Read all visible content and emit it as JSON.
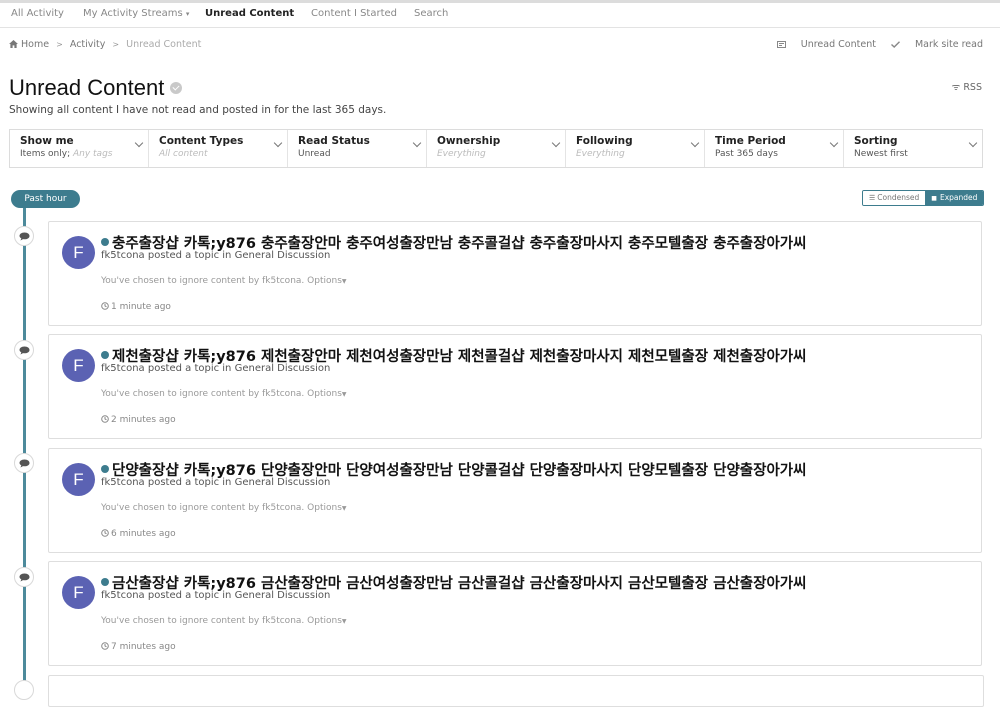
{
  "nav": {
    "tabs": [
      {
        "label": "All Activity"
      },
      {
        "label": "My Activity Streams",
        "caret": "▾"
      },
      {
        "label": "Unread Content"
      },
      {
        "label": "Content I Started"
      },
      {
        "label": "Search"
      }
    ]
  },
  "breadcrumb": {
    "items": [
      "Home",
      "Activity",
      "Unread Content"
    ]
  },
  "header_actions": {
    "unread": "Unread Content",
    "mark_read": "Mark site read"
  },
  "page": {
    "title": "Unread Content",
    "subtitle": "Showing all content I have not read and posted in for the last 365 days.",
    "rss": "RSS"
  },
  "filters": [
    {
      "title": "Show me",
      "value": "Items only;",
      "placeholder": "Any tags"
    },
    {
      "title": "Content Types",
      "value": "",
      "placeholder": "All content"
    },
    {
      "title": "Read Status",
      "value": "Unread",
      "placeholder": ""
    },
    {
      "title": "Ownership",
      "value": "",
      "placeholder": "Everything"
    },
    {
      "title": "Following",
      "value": "",
      "placeholder": "Everything"
    },
    {
      "title": "Time Period",
      "value": "Past 365 days",
      "placeholder": ""
    },
    {
      "title": "Sorting",
      "value": "Newest first",
      "placeholder": ""
    }
  ],
  "timeline": {
    "period_label": "Past hour",
    "view_condensed": "Condensed",
    "view_expanded": "Expanded"
  },
  "items": [
    {
      "avatar": "F",
      "title": "충주출장샵 카톡;y876 충주출장안마 충주여성출장만남 충주콜걸샵 충주출장마사지 충주모텔출장 충주출장아가씨",
      "meta": "fk5tcona posted a topic in General Discussion",
      "ignore": "You've chosen to ignore content by fk5tcona.",
      "options": "Options",
      "time": "1 minute ago"
    },
    {
      "avatar": "F",
      "title": "제천출장샵 카톡;y876 제천출장안마 제천여성출장만남 제천콜걸샵 제천출장마사지 제천모텔출장 제천출장아가씨",
      "meta": "fk5tcona posted a topic in General Discussion",
      "ignore": "You've chosen to ignore content by fk5tcona.",
      "options": "Options",
      "time": "2 minutes ago"
    },
    {
      "avatar": "F",
      "title": "단양출장샵 카톡;y876 단양출장안마 단양여성출장만남 단양콜걸샵 단양출장마사지 단양모텔출장 단양출장아가씨",
      "meta": "fk5tcona posted a topic in General Discussion",
      "ignore": "You've chosen to ignore content by fk5tcona.",
      "options": "Options",
      "time": "6 minutes ago"
    },
    {
      "avatar": "F",
      "title": "금산출장샵 카톡;y876 금산출장안마 금산여성출장만남 금산콜걸샵 금산출장마사지 금산모텔출장 금산출장아가씨",
      "meta": "fk5tcona posted a topic in General Discussion",
      "ignore": "You've chosen to ignore content by fk5tcona.",
      "options": "Options",
      "time": "7 minutes ago"
    }
  ]
}
